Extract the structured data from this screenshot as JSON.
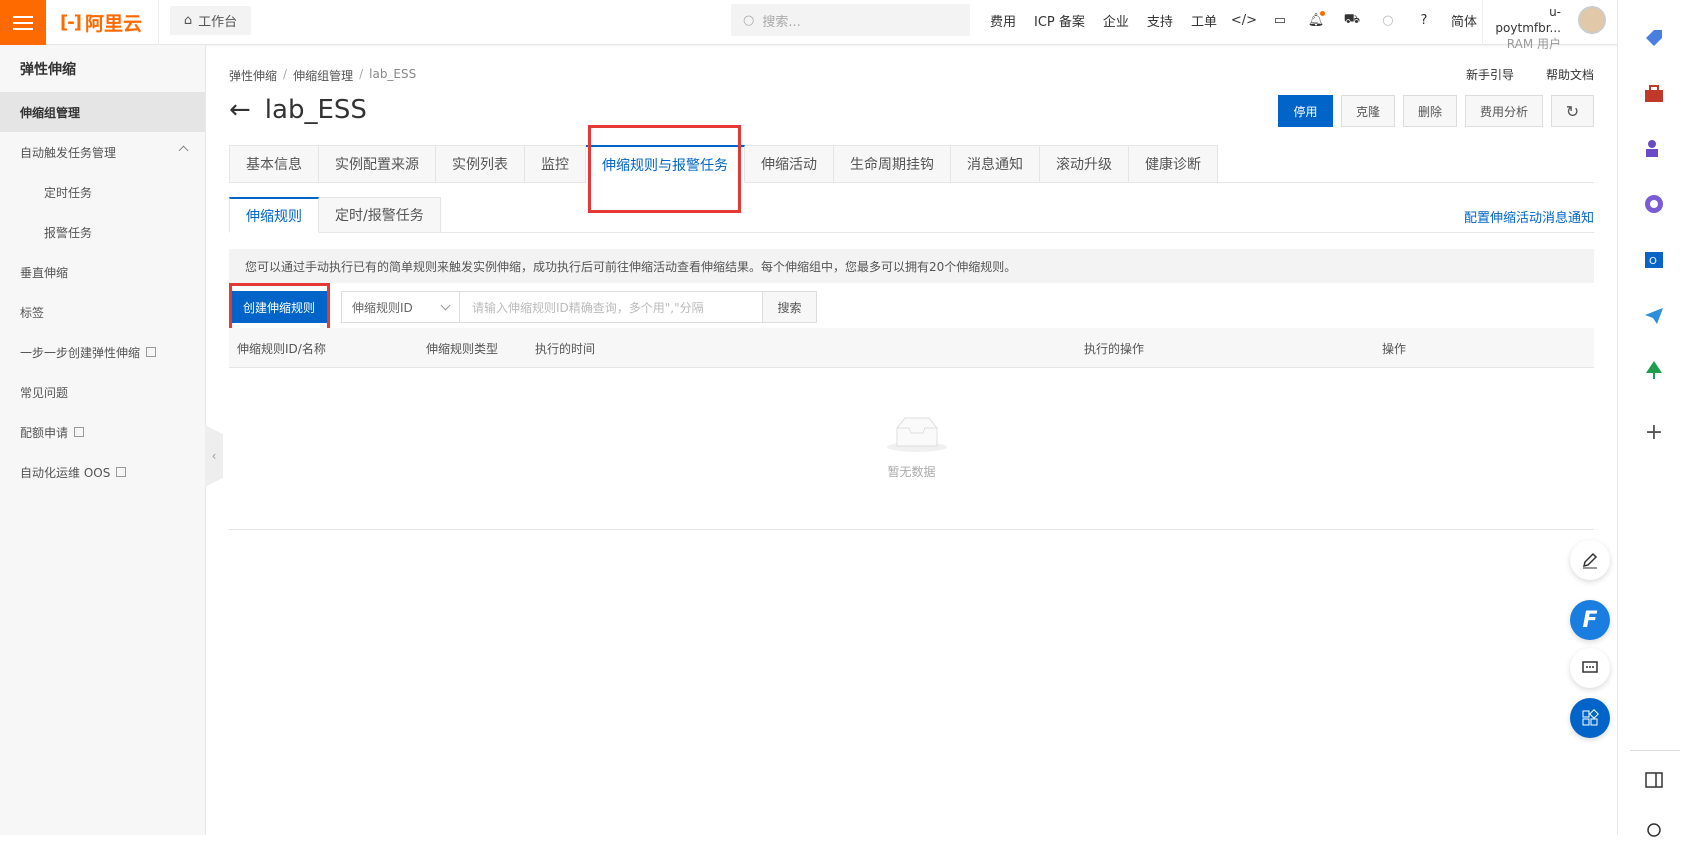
{
  "header": {
    "logo_text": "阿里云",
    "workbench": "工作台",
    "search_placeholder": "搜索...",
    "nav": [
      "费用",
      "ICP 备案",
      "企业",
      "支持",
      "工单"
    ],
    "lang": "简体",
    "user_name": "u-poytmfbr...",
    "user_role": "RAM 用户"
  },
  "sidebar": {
    "title": "弹性伸缩",
    "items": [
      {
        "label": "伸缩组管理"
      },
      {
        "label": "自动触发任务管理"
      },
      {
        "label": "定时任务"
      },
      {
        "label": "报警任务"
      },
      {
        "label": "垂直伸缩"
      },
      {
        "label": "标签"
      },
      {
        "label": "一步一步创建弹性伸缩"
      },
      {
        "label": "常见问题"
      },
      {
        "label": "配额申请"
      },
      {
        "label": "自动化运维 OOS"
      }
    ]
  },
  "breadcrumb": [
    "弹性伸缩",
    "伸缩组管理",
    "lab_ESS"
  ],
  "help_links": [
    "新手引导",
    "帮助文档"
  ],
  "page_title": "lab_ESS",
  "actions": [
    "停用",
    "克隆",
    "删除",
    "费用分析"
  ],
  "tabs": [
    "基本信息",
    "实例配置来源",
    "实例列表",
    "监控",
    "伸缩规则与报警任务",
    "伸缩活动",
    "生命周期挂钩",
    "消息通知",
    "滚动升级",
    "健康诊断"
  ],
  "subtabs": [
    "伸缩规则",
    "定时/报警任务"
  ],
  "config_link": "配置伸缩活动消息通知",
  "notice": "您可以通过手动执行已有的简单规则来触发实例伸缩，成功执行后可前往伸缩活动查看伸缩结果。每个伸缩组中，您最多可以拥有20个伸缩规则。",
  "toolbar": {
    "create": "创建伸缩规则",
    "select": "伸缩规则ID",
    "query_placeholder": "请输入伸缩规则ID精确查询，多个用\",\"分隔",
    "search": "搜索"
  },
  "table": {
    "columns": [
      "伸缩规则ID/名称",
      "伸缩规则类型",
      "执行的时间",
      "执行的操作",
      "操作"
    ],
    "empty": "暂无数据"
  },
  "colors": {
    "brand": "#ff6a00",
    "primary": "#0064c8",
    "highlight": "#e53935"
  }
}
